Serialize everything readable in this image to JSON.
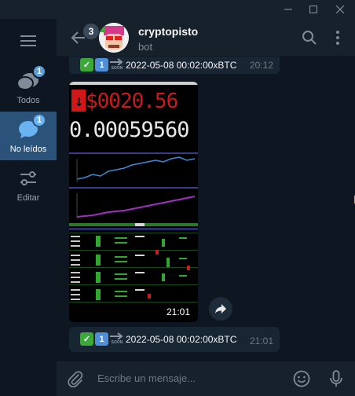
{
  "window": {
    "controls": [
      "minimize",
      "maximize",
      "close"
    ]
  },
  "sidebar": {
    "menu_icon": "hamburger-icon",
    "folders": [
      {
        "label": "Todos",
        "badge": "1",
        "icon": "chat-bubbles-icon",
        "active": false
      },
      {
        "label": "No leídos",
        "badge": "1",
        "icon": "chat-bubble-icon",
        "active": true
      },
      {
        "label": "Editar",
        "icon": "sliders-icon",
        "active": false
      }
    ]
  },
  "header": {
    "back_badge": "3",
    "title": "cryptopisto",
    "subtitle": "bot"
  },
  "messages": [
    {
      "text": "2022-05-08 00:02:00xBTC",
      "time": "20:12",
      "emojis": [
        "white-check-mark",
        "keycap-one",
        "soon-arrow"
      ]
    },
    {
      "media": {
        "price": "$0020.56",
        "amount": "0.00059560",
        "duration": "21:01"
      }
    },
    {
      "text": "2022-05-08 00:02:00xBTC",
      "time": "21:01",
      "emojis": [
        "white-check-mark",
        "keycap-one",
        "soon-arrow"
      ],
      "emoji_text": {
        "check": "✓",
        "one": "1",
        "soon": "SOON"
      }
    }
  ],
  "composer": {
    "placeholder": "Escribe un mensaje..."
  },
  "colors": {
    "accent": "#6ab3f3",
    "active_folder": "#2b5278",
    "bubble": "#182533",
    "price_red": "#d01818"
  }
}
